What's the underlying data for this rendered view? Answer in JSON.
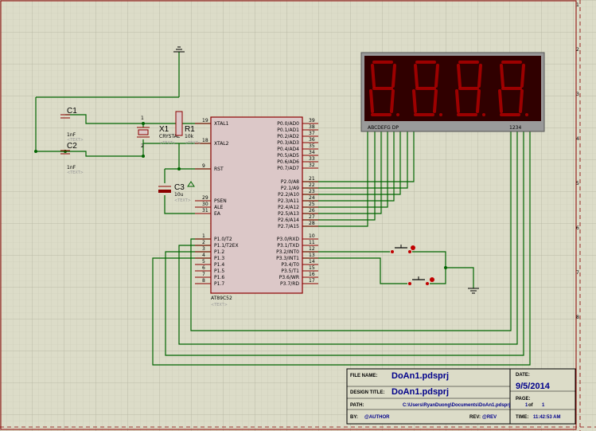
{
  "mcu": {
    "part": "AT89C52",
    "text_placeholder": "<TEXT>",
    "left_pins": [
      {
        "num": "19",
        "name": "XTAL1"
      },
      {
        "num": "18",
        "name": "XTAL2"
      },
      {
        "num": "9",
        "name": "RST"
      },
      {
        "num": "29",
        "name": "PSEN"
      },
      {
        "num": "30",
        "name": "ALE"
      },
      {
        "num": "31",
        "name": "EA"
      },
      {
        "num": "1",
        "name": "P1.0/T2"
      },
      {
        "num": "2",
        "name": "P1.1/T2EX"
      },
      {
        "num": "3",
        "name": "P1.2"
      },
      {
        "num": "4",
        "name": "P1.3"
      },
      {
        "num": "5",
        "name": "P1.4"
      },
      {
        "num": "6",
        "name": "P1.5"
      },
      {
        "num": "7",
        "name": "P1.6"
      },
      {
        "num": "8",
        "name": "P1.7"
      }
    ],
    "right_pins": [
      {
        "num": "39",
        "name": "P0.0/AD0"
      },
      {
        "num": "38",
        "name": "P0.1/AD1"
      },
      {
        "num": "37",
        "name": "P0.2/AD2"
      },
      {
        "num": "36",
        "name": "P0.3/AD3"
      },
      {
        "num": "35",
        "name": "P0.4/AD4"
      },
      {
        "num": "34",
        "name": "P0.5/AD5"
      },
      {
        "num": "33",
        "name": "P0.6/AD6"
      },
      {
        "num": "32",
        "name": "P0.7/AD7"
      },
      {
        "num": "21",
        "name": "P2.0/A8"
      },
      {
        "num": "22",
        "name": "P2.1/A9"
      },
      {
        "num": "23",
        "name": "P2.2/A10"
      },
      {
        "num": "24",
        "name": "P2.3/A11"
      },
      {
        "num": "25",
        "name": "P2.4/A12"
      },
      {
        "num": "26",
        "name": "P2.5/A13"
      },
      {
        "num": "27",
        "name": "P2.6/A14"
      },
      {
        "num": "28",
        "name": "P2.7/A15"
      },
      {
        "num": "10",
        "name": "P3.0/RXD"
      },
      {
        "num": "11",
        "name": "P3.1/TXD"
      },
      {
        "num": "12",
        "name": "P3.2/INT0"
      },
      {
        "num": "13",
        "name": "P3.3/INT1"
      },
      {
        "num": "14",
        "name": "P3.4/T0"
      },
      {
        "num": "15",
        "name": "P3.5/T1"
      },
      {
        "num": "16",
        "name": "P3.6/WR"
      },
      {
        "num": "17",
        "name": "P3.7/RD"
      }
    ]
  },
  "components": {
    "c1": {
      "ref": "C1",
      "value": "1nF",
      "text": "<TEXT>"
    },
    "c2": {
      "ref": "C2",
      "value": "1nF",
      "text": "<TEXT>"
    },
    "x1": {
      "ref": "X1",
      "value": "CRYSTAL",
      "text": "<TEXT>"
    },
    "r1": {
      "ref": "R1",
      "value": "10k",
      "text": "<TEXT>"
    },
    "c3": {
      "ref": "C3",
      "value": "10u",
      "text": "<TEXT>"
    },
    "x1_pins": [
      "1",
      "2"
    ]
  },
  "display": {
    "segment_labels": "ABCDEFG DP",
    "digit_labels": "1234",
    "digits": 4
  },
  "ruler": [
    "1",
    "2",
    "3",
    "4",
    "5",
    "6",
    "7",
    "8"
  ],
  "title_block": {
    "file_name_label": "FILE NAME:",
    "file_name": "DoAn1.pdsprj",
    "design_title_label": "DESIGN TITLE:",
    "design_title": "DoAn1.pdsprj",
    "path_label": "PATH:",
    "path": "C:\\Users\\RyanDuong\\Documents\\DoAn1.pdsprj",
    "by_label": "BY:",
    "by": "@AUTHOR",
    "rev_label": "REV:",
    "rev": "@REV",
    "date_label": "DATE:",
    "date": "9/5/2014",
    "page_label": "PAGE:",
    "page": "1",
    "of_label": "of",
    "of": "1",
    "time_label": "TIME:",
    "time": "11:42:53 AM"
  },
  "colors": {
    "wire": "#006400",
    "component": "#8b0000",
    "display_bg": "#300000",
    "segment": "#c00000",
    "grid": "#c8c8b4",
    "background": "#dcdcc8"
  }
}
